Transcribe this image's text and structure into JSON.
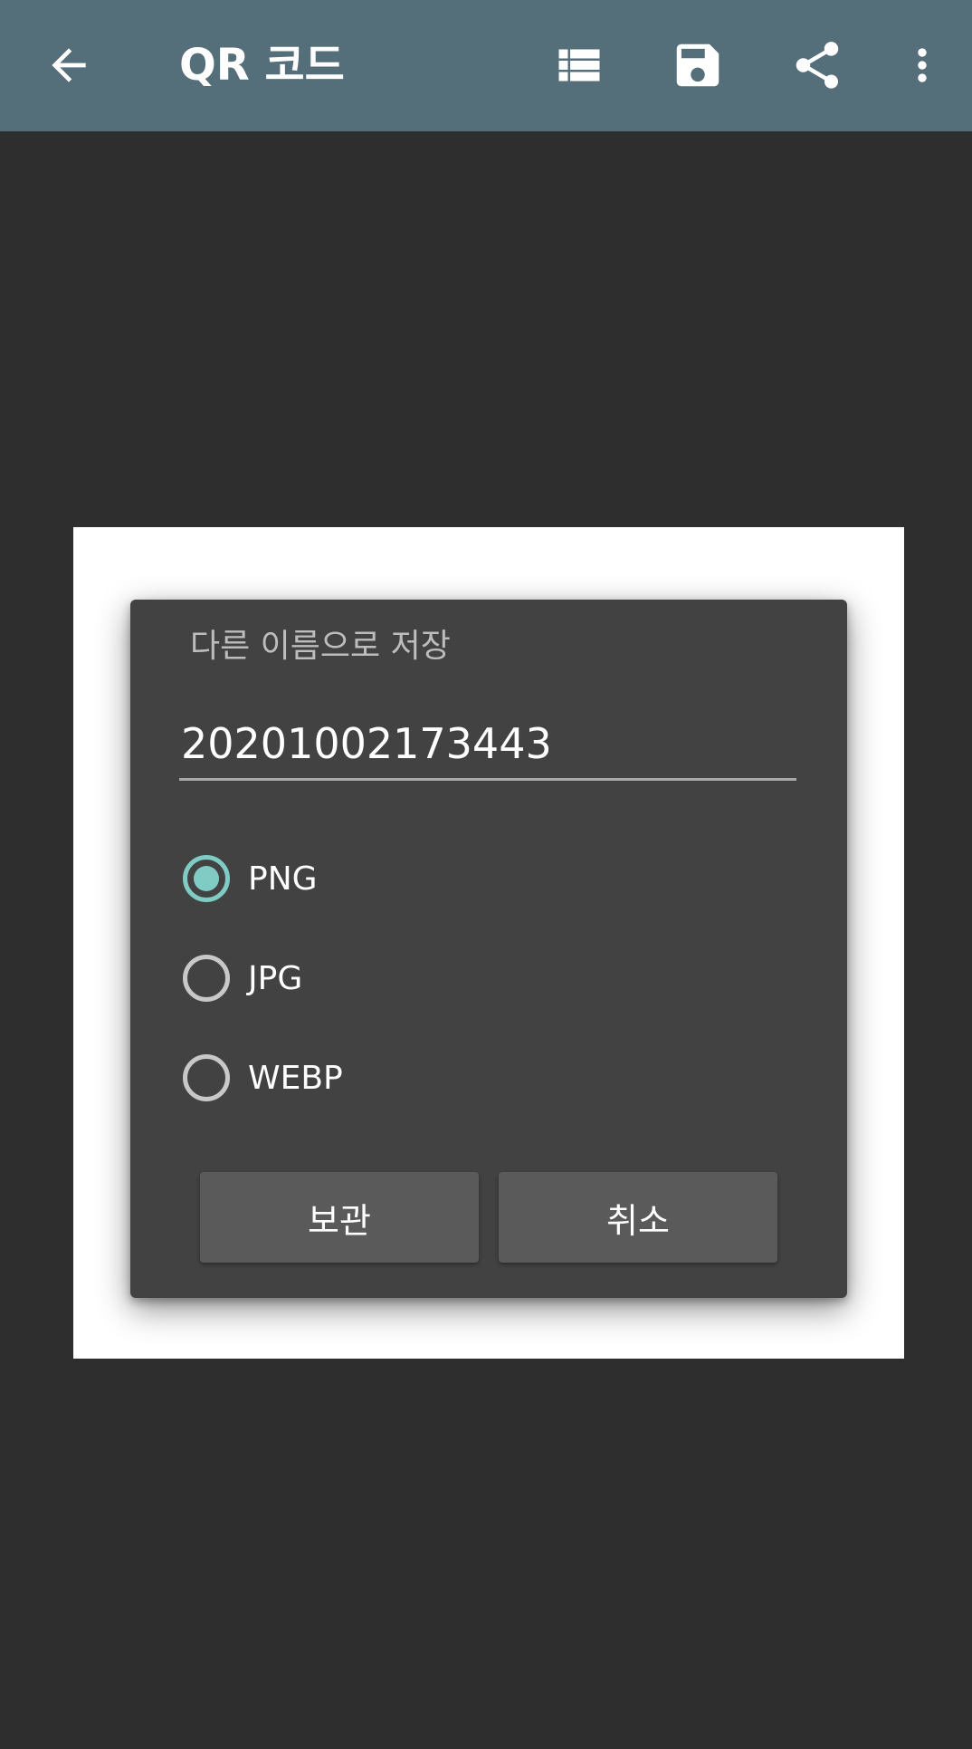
{
  "toolbar": {
    "title": "QR 코드",
    "back_icon": "arrow-back-icon",
    "list_icon": "list-icon",
    "save_icon": "save-icon",
    "share_icon": "share-icon",
    "more_icon": "more-vert-icon",
    "background_color": "#546e7a"
  },
  "dialog": {
    "title": "다른 이름으로 저장",
    "filename_value": "20201002173443",
    "formats": [
      {
        "label": "PNG",
        "checked": true
      },
      {
        "label": "JPG",
        "checked": false
      },
      {
        "label": "WEBP",
        "checked": false
      }
    ],
    "save_label": "보관",
    "cancel_label": "취소",
    "accent_color": "#80cbc4"
  }
}
